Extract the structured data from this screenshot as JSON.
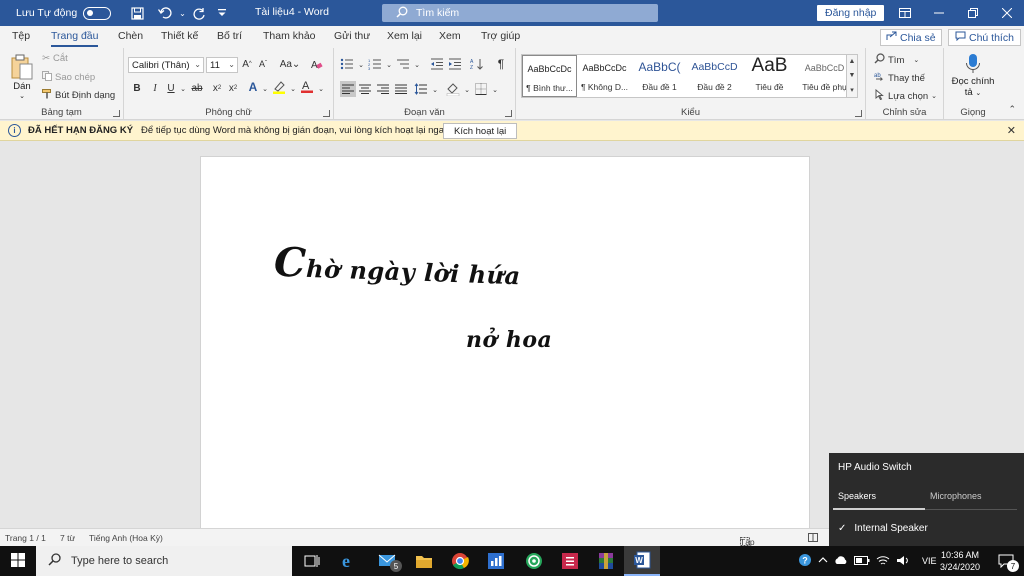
{
  "titlebar": {
    "autosave_label": "Lưu Tự động",
    "doc_title": "Tài liệu4  -  Word",
    "search_placeholder": "Tìm kiếm",
    "signin_label": "Đăng nhập"
  },
  "menu": {
    "tabs": [
      "Tệp",
      "Trang đầu",
      "Chèn",
      "Thiết kế",
      "Bố trí",
      "Tham khảo",
      "Gửi thư",
      "Xem lại",
      "Xem",
      "Trợ giúp"
    ],
    "active_tab": "Trang đầu",
    "share_label": "Chia sẻ",
    "comment_label": "Chú thích"
  },
  "ribbon": {
    "clipboard": {
      "paste_label": "Dán",
      "cut_label": "Cắt",
      "copy_label": "Sao chép",
      "format_painter_label": "Bút Định dạng",
      "group_label": "Bảng tạm"
    },
    "font": {
      "font_name": "Calibri (Thân)",
      "font_size": "11",
      "case_label": "Aa",
      "group_label": "Phông chữ"
    },
    "paragraph": {
      "group_label": "Đoạn văn"
    },
    "styles": {
      "items": [
        {
          "preview": "AaBbCcDc",
          "name": "¶ Bình thư..."
        },
        {
          "preview": "AaBbCcDc",
          "name": "¶ Không D..."
        },
        {
          "preview": "AaBbC(",
          "name": "Đầu đề 1"
        },
        {
          "preview": "AaBbCcD",
          "name": "Đầu đề 2"
        },
        {
          "preview": "AaB",
          "name": "Tiêu đề"
        },
        {
          "preview": "AaBbCcD",
          "name": "Tiêu đề phụ"
        }
      ],
      "group_label": "Kiểu"
    },
    "editing": {
      "find_label": "Tìm",
      "replace_label": "Thay thế",
      "select_label": "Lựa chọn",
      "group_label": "Chỉnh sửa"
    },
    "voice": {
      "dictate_label_1": "Đọc chính",
      "dictate_label_2": "tả",
      "group_label": "Giọng"
    }
  },
  "notification": {
    "title": "ĐÃ HẾT HẠN ĐĂNG KÝ",
    "message": "Để tiếp tục dùng Word mà không bị gián đoạn, vui lòng kích hoạt lại ngay.",
    "button_label": "Kích hoạt lại"
  },
  "document": {
    "line1_cap": "C",
    "line1_rest": "hờ ngày lời hứa",
    "line2": "nở hoa"
  },
  "statusbar": {
    "page": "Trang 1 / 1",
    "words": "7 từ",
    "language": "Tiếng Anh (Hoa Kỳ)",
    "focus_label": "Tập trung"
  },
  "audio_switch": {
    "title": "HP Audio Switch",
    "tab_speakers": "Speakers",
    "tab_microphones": "Microphones",
    "device": "Internal Speaker",
    "check": "✓"
  },
  "taskbar": {
    "search_placeholder": "Type here to search",
    "mail_badge": "5",
    "language": "VIE",
    "time": "10:36 AM",
    "date": "3/24/2020",
    "notif_badge": "7"
  }
}
